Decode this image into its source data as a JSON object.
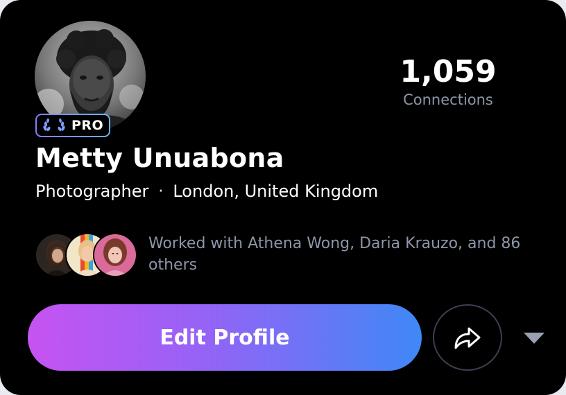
{
  "profile": {
    "badge": "PRO",
    "name": "Metty Unuabona",
    "occupation": "Photographer",
    "separator": "·",
    "location": "London, United Kingdom"
  },
  "stats": {
    "count": "1,059",
    "label": "Connections"
  },
  "collaborators": {
    "text": "Worked with Athena Wong, Daria Krauzo, and 86 others",
    "avatars": [
      "collaborator-avatar-1",
      "collaborator-avatar-2",
      "collaborator-avatar-3"
    ]
  },
  "actions": {
    "edit_label": "Edit Profile",
    "share_icon": "share-arrow-icon",
    "dropdown_icon": "chevron-down-icon"
  },
  "colors": {
    "background": "#000000",
    "muted_text": "#8e95a8",
    "gradient_start": "#c653f2",
    "gradient_end": "#3f88f6",
    "outline": "#3c4050"
  }
}
